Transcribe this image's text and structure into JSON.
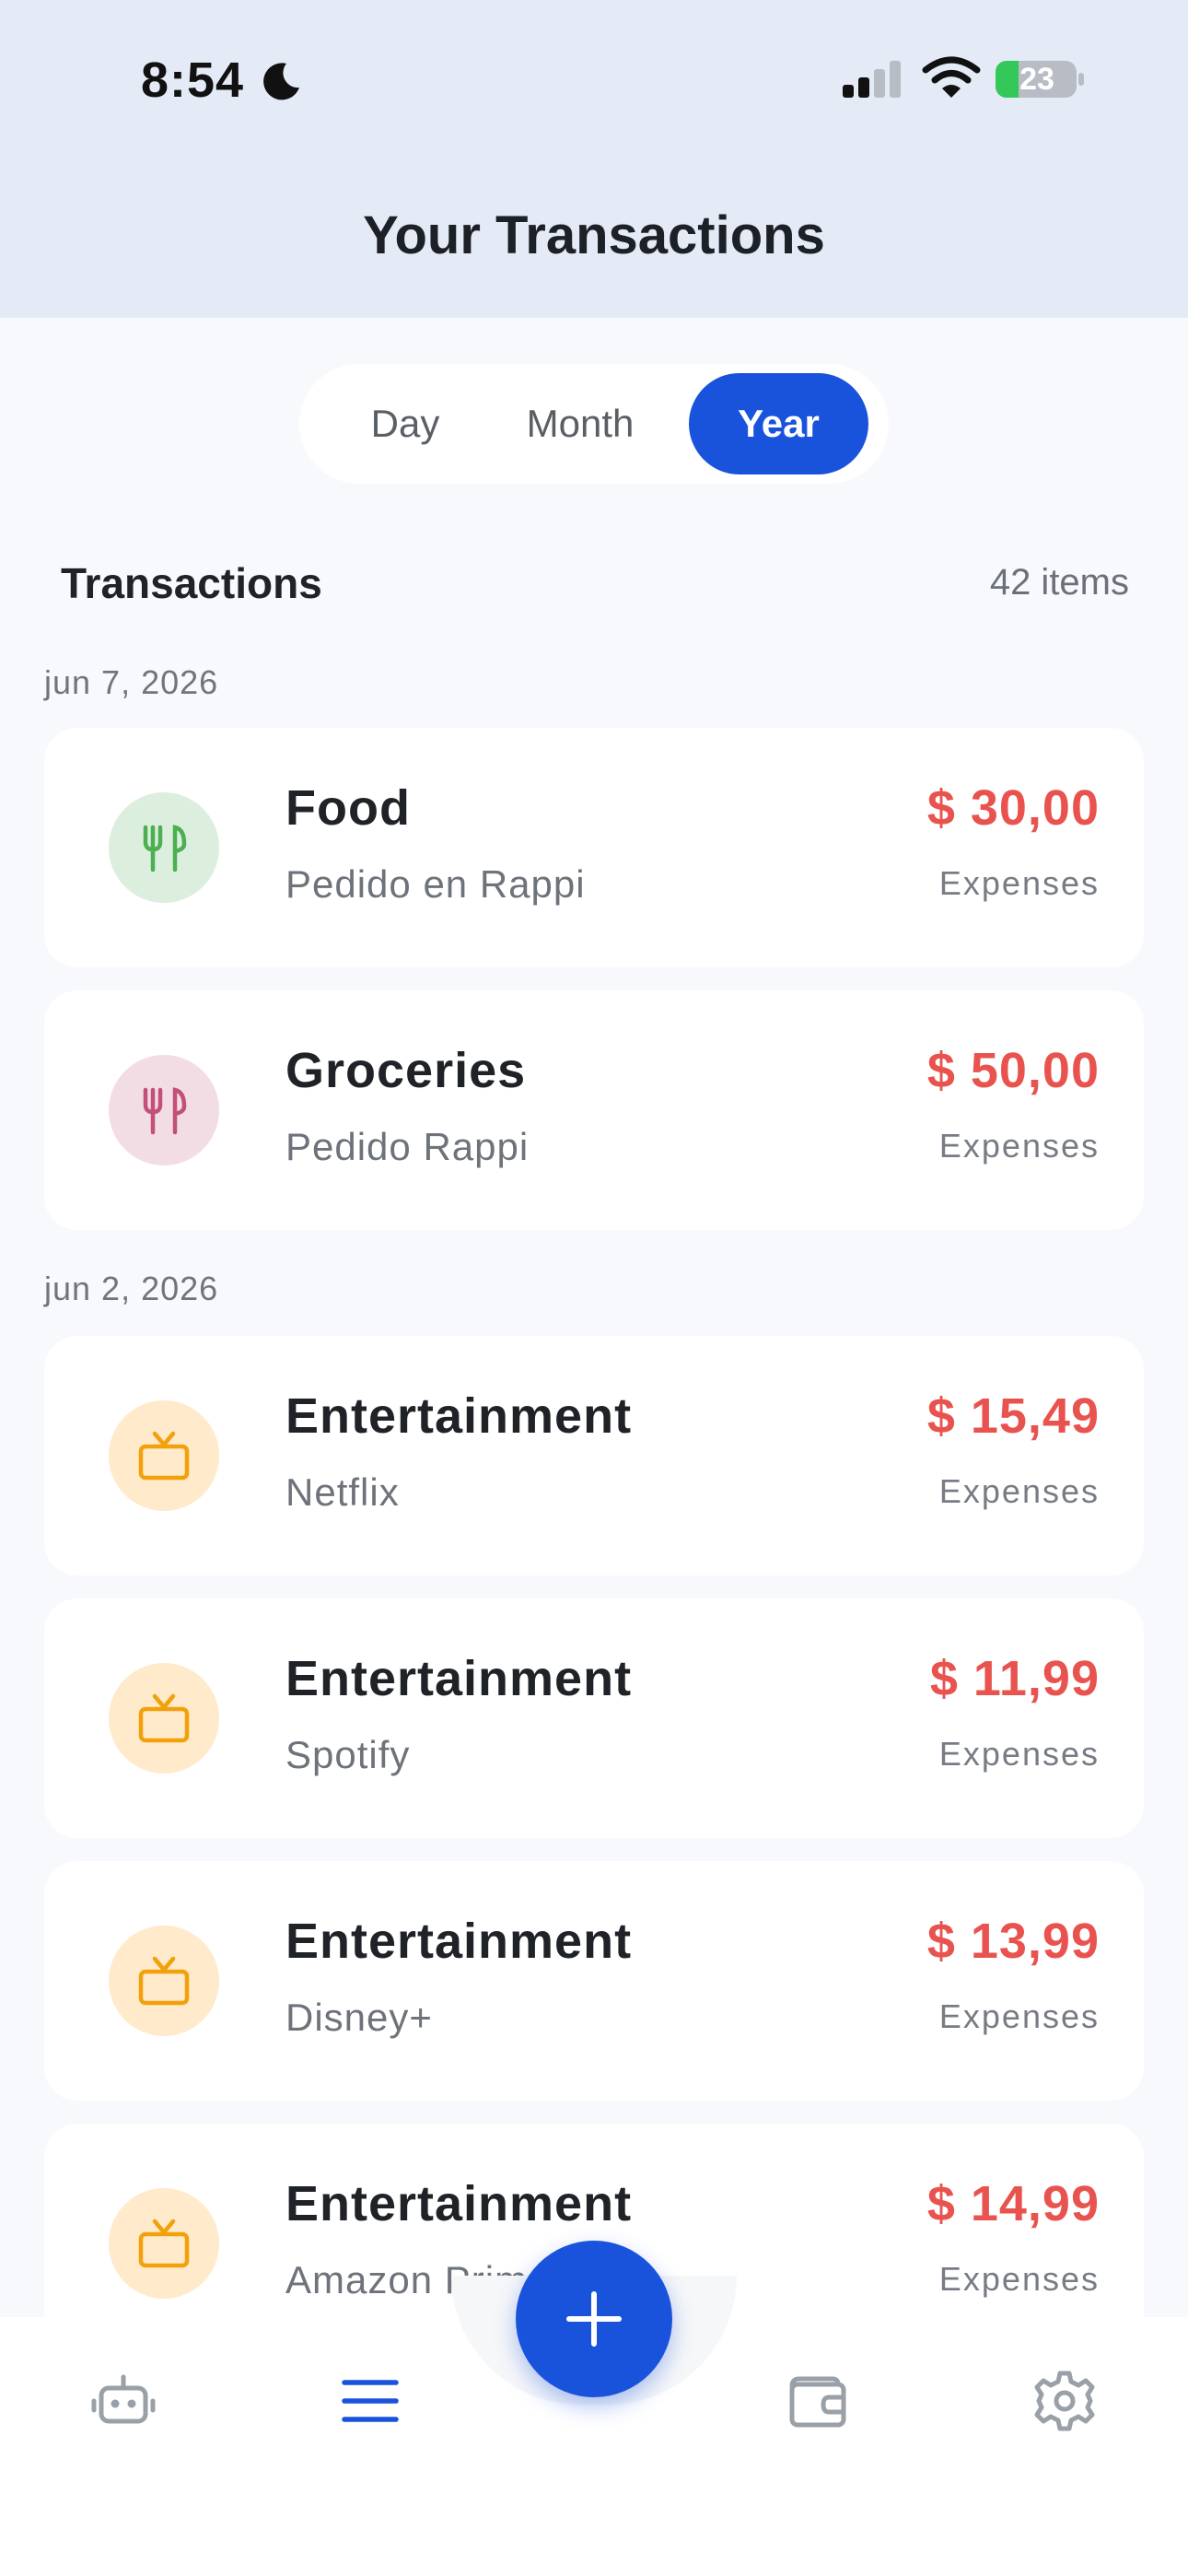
{
  "status_bar": {
    "time": "8:54",
    "battery": "23"
  },
  "header": {
    "title": "Your Transactions"
  },
  "period_tabs": {
    "day": "Day",
    "month": "Month",
    "year": "Year",
    "selected": "Year"
  },
  "section": {
    "title": "Transactions",
    "count": "42 items"
  },
  "groups": [
    {
      "date": "jun 7, 2026",
      "items": [
        {
          "icon": "fork-knife-icon",
          "color": "#4caf50",
          "title": "Food",
          "subtitle": "Pedido en Rappi",
          "amount": "$ 30,00",
          "type": "Expenses"
        },
        {
          "icon": "fork-knife-icon",
          "color": "#c2507a",
          "title": "Groceries",
          "subtitle": "Pedido Rappi",
          "amount": "$ 50,00",
          "type": "Expenses"
        }
      ]
    },
    {
      "date": "jun 2, 2026",
      "items": [
        {
          "icon": "tv-icon",
          "color": "#f2a10a",
          "title": "Entertainment",
          "subtitle": "Netflix",
          "amount": "$ 15,49",
          "type": "Expenses"
        },
        {
          "icon": "tv-icon",
          "color": "#f2a10a",
          "title": "Entertainment",
          "subtitle": "Spotify",
          "amount": "$ 11,99",
          "type": "Expenses"
        },
        {
          "icon": "tv-icon",
          "color": "#f2a10a",
          "title": "Entertainment",
          "subtitle": "Disney+",
          "amount": "$ 13,99",
          "type": "Expenses"
        },
        {
          "icon": "tv-icon",
          "color": "#f2a10a",
          "title": "Entertainment",
          "subtitle": "Amazon Prime",
          "amount": "$ 14,99",
          "type": "Expenses"
        }
      ]
    }
  ],
  "colors": {
    "accent": "#1a53db",
    "expense": "#e9534f",
    "header_bg": "#e5ebf6"
  },
  "tabbar": {
    "items": [
      "robot-icon",
      "list-icon",
      "add-icon",
      "wallet-icon",
      "settings-icon"
    ],
    "active": "list-icon"
  }
}
